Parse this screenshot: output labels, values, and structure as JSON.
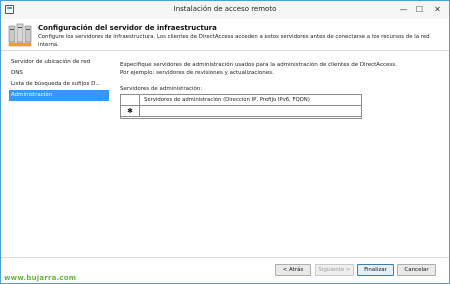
{
  "window": {
    "title": "Instalación de acceso remoto",
    "controls": {
      "minimize": "—",
      "maximize": "☐",
      "close": "✕"
    },
    "icon": "app-window-icon"
  },
  "header": {
    "title": "Configuración del servidor de infraestructura",
    "description": "Configure los servidores de infraestructura. Los clientes de DirectAccess acceden a estos servidores antes de conectarse a los recursos de la red interna.",
    "icon": "servers-icon"
  },
  "sidebar": {
    "items": [
      {
        "label": "Servidor de ubicación de red",
        "active": false
      },
      {
        "label": "DNS",
        "active": false
      },
      {
        "label": "Lista de búsqueda de sufijos D...",
        "active": false
      },
      {
        "label": "Administración",
        "active": true
      }
    ]
  },
  "main": {
    "description": "Especifique servidores de administración usados para la administración de clientes de DirectAccess. Por ejemplo: servidores de revisiones y actualizaciones.",
    "servers_label": "Servidores de administración:",
    "grid": {
      "columns": [
        "Servidores de administración (Dirección IP, Prefijo IPv6, FQDN)"
      ],
      "new_row_marker": "✱",
      "rows": []
    }
  },
  "footer": {
    "back": "< Atrás",
    "next": "Siguiente >",
    "finish": "Finalizar",
    "cancel": "Cancelar"
  },
  "watermark": "www.bujarra.com",
  "colors": {
    "accent": "#3399ff",
    "window_border": "#4a9fd6",
    "watermark": "#6db33f"
  }
}
